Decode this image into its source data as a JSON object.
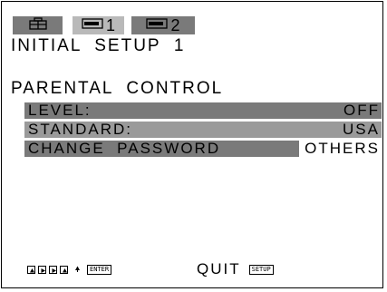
{
  "tabs": [
    {
      "icon": "setup-tool-icon",
      "label": ""
    },
    {
      "icon": "disc-icon",
      "label": "1"
    },
    {
      "icon": "disc-icon",
      "label": "2"
    }
  ],
  "page_title": "INITIAL  SETUP  1",
  "section_title": "PARENTAL  CONTROL",
  "rows": [
    {
      "label": "LEVEL:",
      "value": "OFF"
    },
    {
      "label": "STANDARD:",
      "value": "USA"
    },
    {
      "label": "CHANGE  PASSWORD",
      "value": "OTHERS"
    }
  ],
  "footer": {
    "enter_key": "ENTER",
    "quit_label": "QUIT",
    "setup_key": "SETUP"
  },
  "colors": {
    "dark_row": "#7a7a7a",
    "light_row": "#9a9a9a",
    "active_tab": "#b9b9b9"
  }
}
